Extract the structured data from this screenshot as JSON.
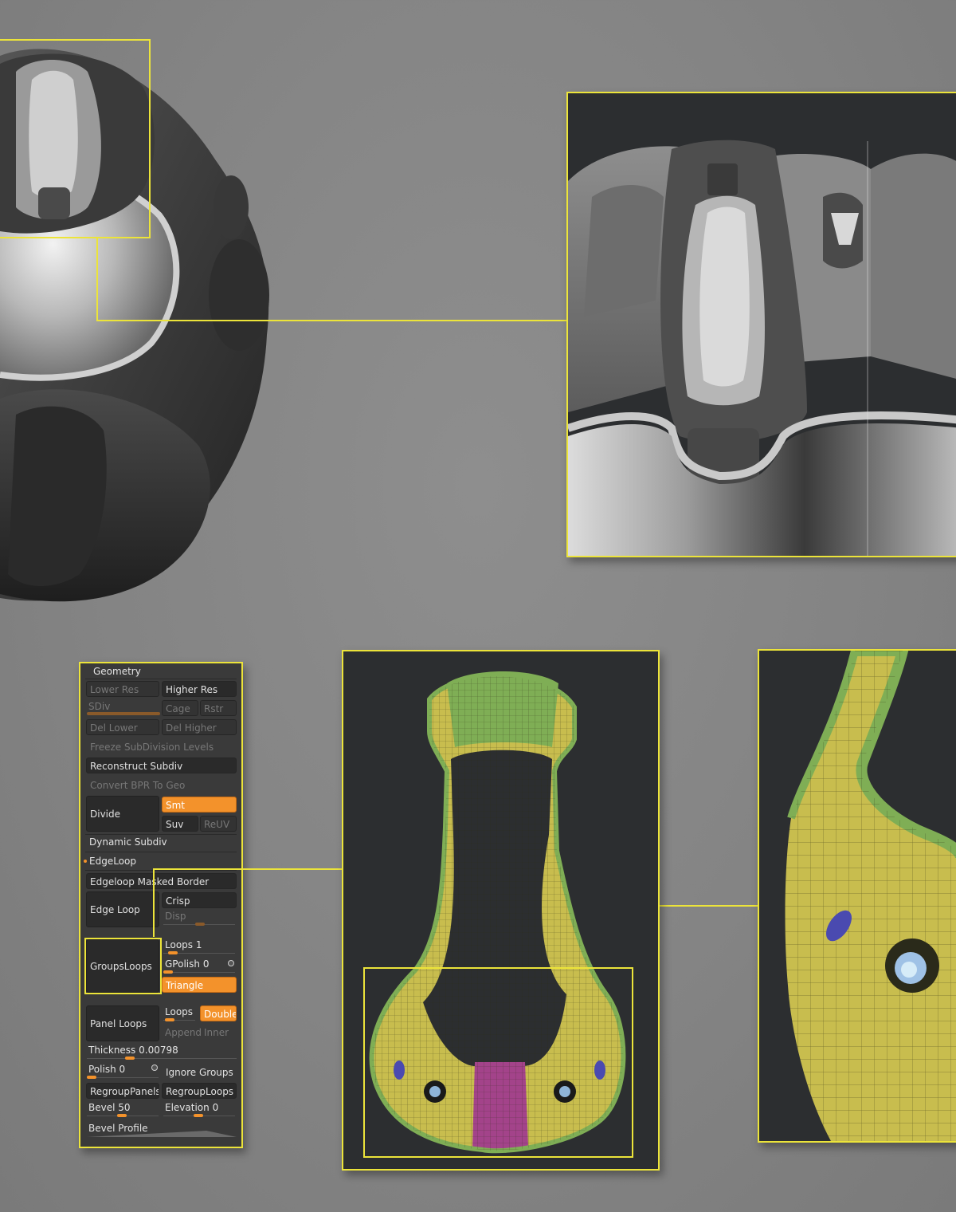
{
  "geometry_panel": {
    "title": "Geometry",
    "lower_res": "Lower Res",
    "higher_res": "Higher Res",
    "sdiv": "SDiv",
    "cage": "Cage",
    "rstr": "Rstr",
    "del_lower": "Del Lower",
    "del_higher": "Del Higher",
    "freeze": "Freeze SubDivision Levels",
    "reconstruct": "Reconstruct Subdiv",
    "convert_bpr": "Convert BPR To Geo",
    "divide": "Divide",
    "smt": "Smt",
    "suv": "Suv",
    "reuv": "ReUV",
    "dynamic_subdiv": "Dynamic Subdiv",
    "edgeloop_header": "EdgeLoop",
    "edgeloop_masked": "Edgeloop Masked Border",
    "edge_loop": "Edge Loop",
    "crisp": "Crisp",
    "disp": "Disp",
    "groups_loops": "GroupsLoops",
    "loops_label": "Loops",
    "loops_value": "1",
    "gpolish_label": "GPolish",
    "gpolish_value": "0",
    "triangle": "Triangle",
    "panel_loops": "Panel Loops",
    "panel_loops_loops": "Loops",
    "double": "Double",
    "append": "Append",
    "inner": "Inner",
    "thickness_label": "Thickness",
    "thickness_value": "0.00798",
    "polish_label": "Polish",
    "polish_value": "0",
    "ignore_groups": "Ignore Groups",
    "regroup_panels": "RegroupPanels",
    "regroup_loops": "RegroupLoops",
    "bevel_label": "Bevel",
    "bevel_value": "50",
    "elevation_label": "Elevation",
    "elevation_value": "0",
    "bevel_profile": "Bevel Profile"
  },
  "colors": {
    "accent": "#f3922b",
    "callout": "#ece43a",
    "mesh_yellow": "#c8bd4e",
    "mesh_green": "#7fae55",
    "mesh_magenta": "#a3438a"
  }
}
